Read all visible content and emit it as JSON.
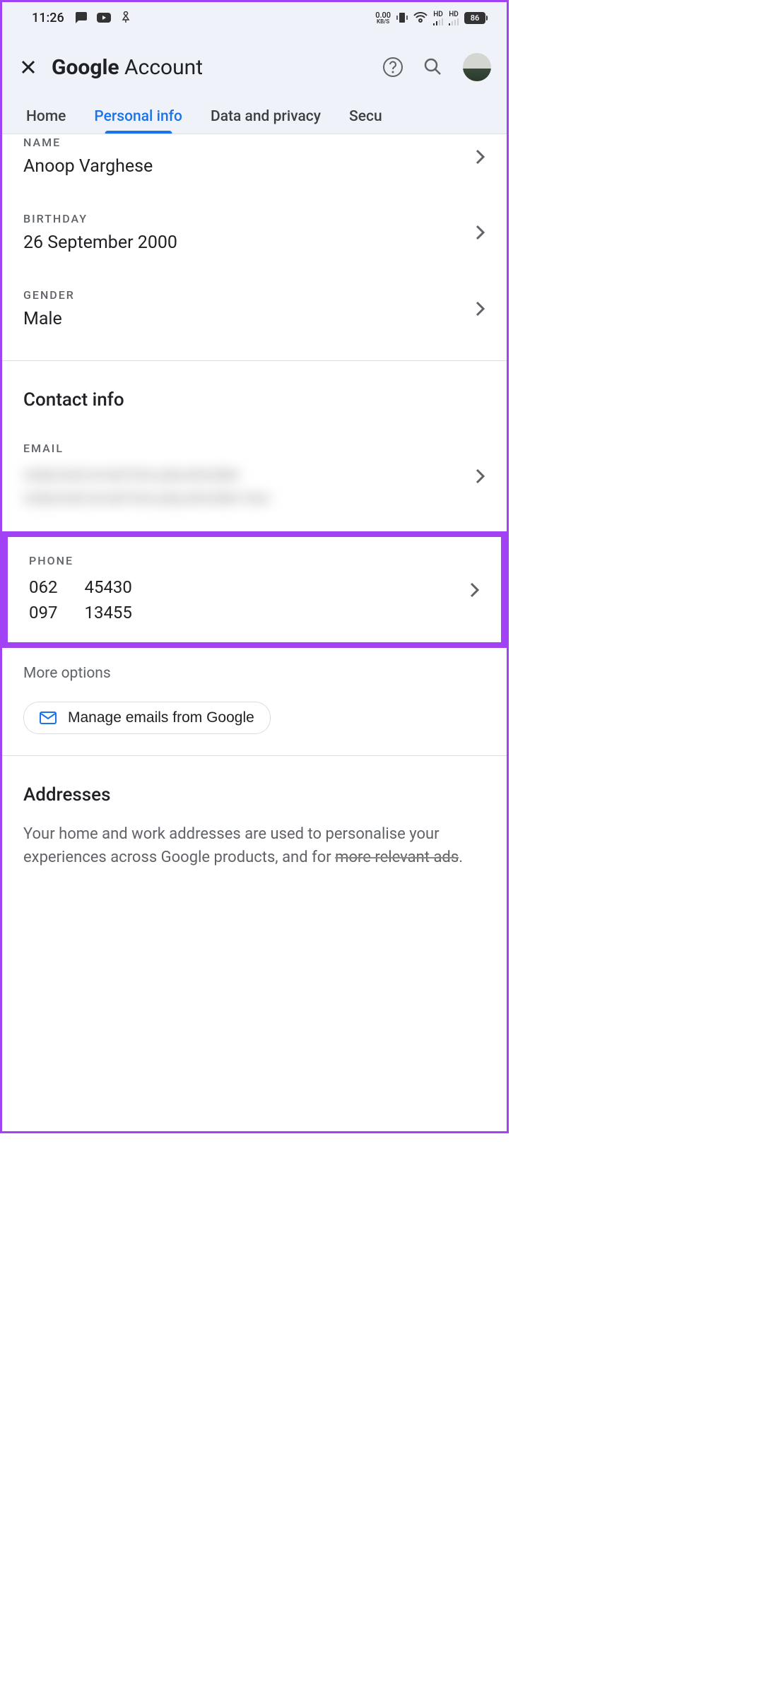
{
  "status": {
    "time": "11:26",
    "net_value": "0.00",
    "net_unit": "KB/S",
    "hd1": "HD",
    "hd2": "HD",
    "battery": "86"
  },
  "header": {
    "brand_bold": "Google",
    "brand_light": " Account"
  },
  "tabs": {
    "home": "Home",
    "personal": "Personal info",
    "privacy": "Data and privacy",
    "security": "Secu"
  },
  "basic": {
    "name_label": "NAME",
    "name_value": "Anoop Varghese",
    "birthday_label": "BIRTHDAY",
    "birthday_value": "26 September 2000",
    "gender_label": "GENDER",
    "gender_value": "Male"
  },
  "contact": {
    "title": "Contact info",
    "email_label": "EMAIL",
    "email_blur_1": "redacted-email-line-placeholder",
    "email_blur_2": "redacted-email-line-placeholder-two",
    "phone_label": "PHONE",
    "phone_1a": "062",
    "phone_1b": "45430",
    "phone_2a": "097",
    "phone_2b": "13455",
    "more_options": "More options",
    "manage_btn": "Manage emails from Google"
  },
  "addresses": {
    "title": "Addresses",
    "desc_1": "Your home and work addresses are used to personalise your experiences across Google products, and for ",
    "desc_strike": "more relevant ads",
    "desc_2": "."
  }
}
